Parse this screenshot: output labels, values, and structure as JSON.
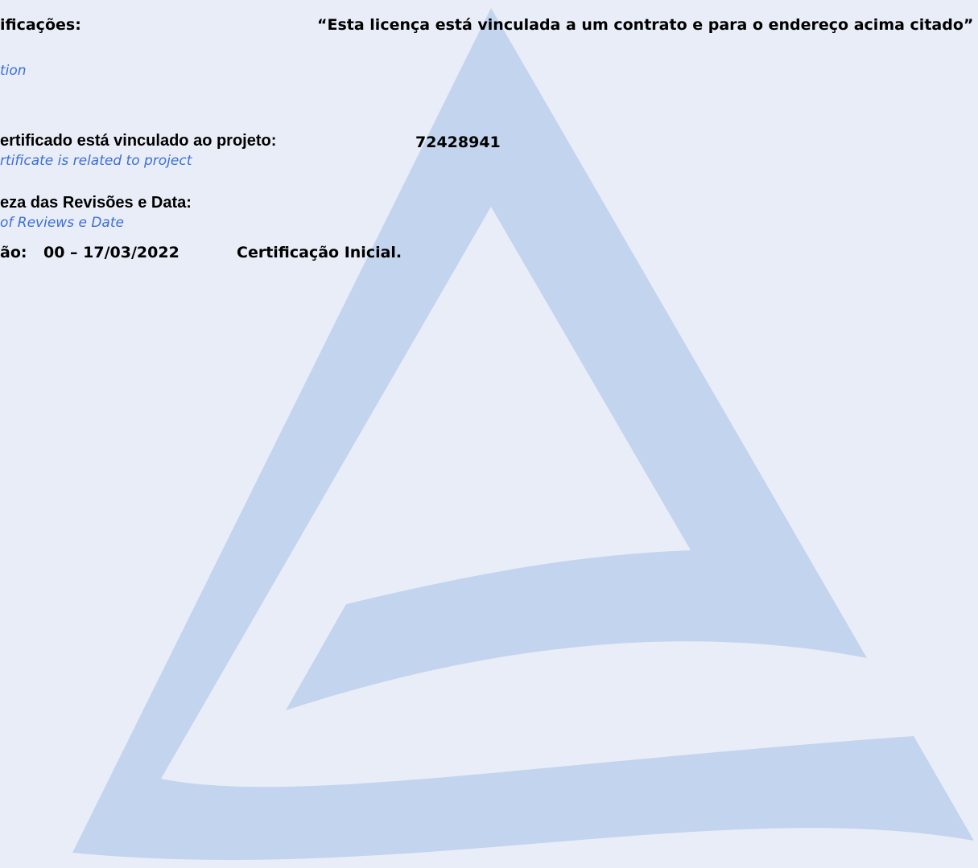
{
  "specs": {
    "label": "ificações:",
    "label_en": "tion",
    "value": "“Esta licença está vinculada a um contrato e para o endereço acima citado”"
  },
  "project": {
    "label": "ertificado está vinculado ao projeto:",
    "label_en": "rtificate is related to project",
    "value": "72428941"
  },
  "revisions": {
    "label": "eza das Revisões e Data:",
    "label_en": " of Reviews e Date",
    "entry_prefix": "ão:",
    "entry_number_date": "00 – 17/03/2022",
    "entry_text": "Certificação Inicial."
  },
  "colors": {
    "background": "#e9edf8",
    "watermark": "#c3d4ee",
    "english_text": "#3b6fd8"
  }
}
